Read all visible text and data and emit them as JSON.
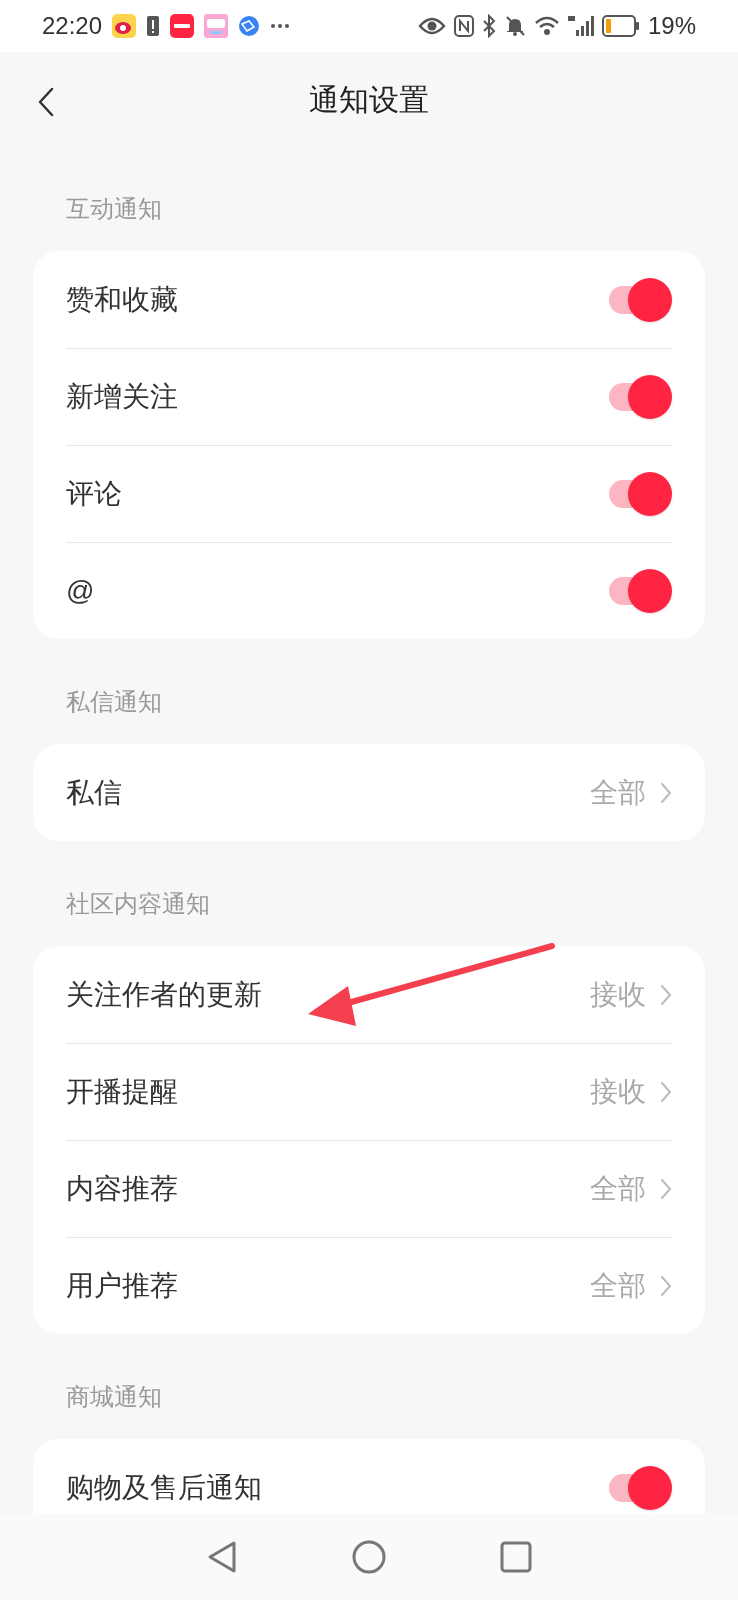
{
  "status_bar": {
    "time": "22:20",
    "battery": "19%"
  },
  "header": {
    "title": "通知设置"
  },
  "sections": [
    {
      "title": "互动通知",
      "items": [
        {
          "kind": "toggle",
          "label": "赞和收藏",
          "on": true
        },
        {
          "kind": "toggle",
          "label": "新增关注",
          "on": true
        },
        {
          "kind": "toggle",
          "label": "评论",
          "on": true
        },
        {
          "kind": "toggle",
          "label": "@",
          "on": true
        }
      ]
    },
    {
      "title": "私信通知",
      "items": [
        {
          "kind": "link",
          "label": "私信",
          "value": "全部"
        }
      ]
    },
    {
      "title": "社区内容通知",
      "items": [
        {
          "kind": "link",
          "label": "关注作者的更新",
          "value": "接收"
        },
        {
          "kind": "link",
          "label": "开播提醒",
          "value": "接收"
        },
        {
          "kind": "link",
          "label": "内容推荐",
          "value": "全部"
        },
        {
          "kind": "link",
          "label": "用户推荐",
          "value": "全部"
        }
      ]
    },
    {
      "title": "商城通知",
      "items": [
        {
          "kind": "toggle",
          "label": "购物及售后通知",
          "on": true
        }
      ]
    }
  ]
}
